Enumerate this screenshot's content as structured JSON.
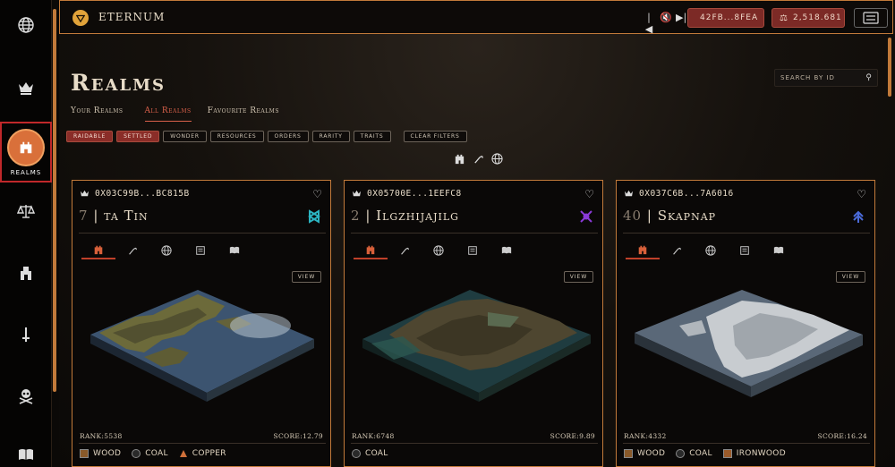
{
  "sidebar": {
    "items": [
      {
        "name": "world",
        "icon": "globe-icon"
      },
      {
        "name": "leaderboard",
        "icon": "crown-icon"
      },
      {
        "name": "realms",
        "icon": "castle-icon",
        "label": "REALMS",
        "active": true
      },
      {
        "name": "bank",
        "icon": "scales-icon"
      },
      {
        "name": "trade",
        "icon": "market-icon"
      },
      {
        "name": "combat",
        "icon": "sword-icon"
      },
      {
        "name": "raid",
        "icon": "skull-icon"
      },
      {
        "name": "lore",
        "icon": "book-icon"
      }
    ]
  },
  "topbar": {
    "brand": "ETERNUM",
    "media": [
      "|◀",
      "🔇",
      "▶|"
    ],
    "address": "42FB...8FEA",
    "balance": "2,518.681"
  },
  "page": {
    "title": "Realms",
    "search_placeholder": "SEARCH BY ID",
    "tabs": [
      {
        "label": "Your Realms",
        "active": false
      },
      {
        "label": "All Realms",
        "active": true
      },
      {
        "label": "Favourite Realms",
        "active": false
      }
    ],
    "filters": [
      {
        "label": "RAIDABLE",
        "active": true
      },
      {
        "label": "SETTLED",
        "active": true
      },
      {
        "label": "WONDER",
        "active": false
      },
      {
        "label": "RESOURCES",
        "active": false
      },
      {
        "label": "ORDERS",
        "active": false
      },
      {
        "label": "RARITY",
        "active": false
      },
      {
        "label": "TRAITS",
        "active": false
      }
    ],
    "clear_filters": "CLEAR FILTERS"
  },
  "cards": [
    {
      "id": "0X03C99B...BC815B",
      "num": "7",
      "name": "ta Tin",
      "order_color": "#2bb3c0",
      "view_label": "VIEW",
      "rank": "RANK:5538",
      "score": "SCORE:12.79",
      "resources": [
        {
          "name": "WOOD",
          "color": "#8a5a2a",
          "shape": "square"
        },
        {
          "name": "COAL",
          "color": "#2a2a2a",
          "shape": "circle"
        },
        {
          "name": "COPPER",
          "color": "#d0703a",
          "shape": "triangle"
        }
      ]
    },
    {
      "id": "0X05700E...1EEFC8",
      "num": "2",
      "name": "Ilgzhijajilg",
      "order_color": "#8a3ad8",
      "view_label": "VIEW",
      "rank": "RANK:6748",
      "score": "SCORE:9.89",
      "resources": [
        {
          "name": "COAL",
          "color": "#2a2a2a",
          "shape": "circle"
        }
      ]
    },
    {
      "id": "0X037C6B...7A6016",
      "num": "40",
      "name": "Skapnap",
      "order_color": "#4a6ad8",
      "view_label": "VIEW",
      "rank": "RANK:4332",
      "score": "SCORE:16.24",
      "resources": [
        {
          "name": "WOOD",
          "color": "#8a5a2a",
          "shape": "square"
        },
        {
          "name": "COAL",
          "color": "#2a2a2a",
          "shape": "circle"
        },
        {
          "name": "IRONWOOD",
          "color": "#9a5a2a",
          "shape": "square"
        }
      ]
    }
  ],
  "colors": {
    "accent": "#c27a3a",
    "active_red": "#c0282a",
    "filter_red": "#8a2d28"
  }
}
